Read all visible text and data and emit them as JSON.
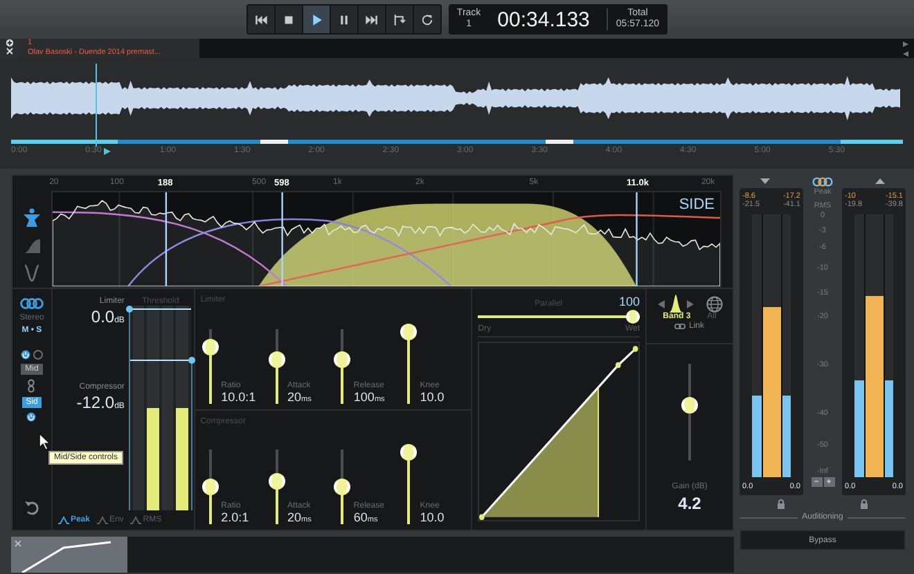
{
  "transport": {
    "buttons": [
      {
        "kind": "previous",
        "selected": false
      },
      {
        "kind": "stop",
        "selected": false
      },
      {
        "kind": "play",
        "selected": true
      },
      {
        "kind": "pause",
        "selected": false
      },
      {
        "kind": "next",
        "selected": false
      },
      {
        "kind": "loop",
        "selected": false
      },
      {
        "kind": "repeat",
        "selected": false
      }
    ],
    "track_label": "Track",
    "track_number": "1",
    "time": "00:34.133",
    "total_label": "Total",
    "total_time": "05:57.120"
  },
  "file_tab": {
    "number": "1",
    "title": "Olav Basoski - Duende 2014 premast..."
  },
  "timeline": {
    "playback": {
      "level": 0.094
    },
    "ticks": [
      "0:00",
      "0:30",
      "1:00",
      "1:30",
      "2:00",
      "2:30",
      "3:00",
      "3:30",
      "4:00",
      "4:30",
      "5:00",
      "5:30"
    ]
  },
  "spectrum": {
    "mode_label": "SIDE",
    "tools": [
      {
        "kind": "figure",
        "selected": true
      },
      {
        "kind": "shelf",
        "selected": false
      },
      {
        "kind": "notch",
        "selected": false
      }
    ],
    "scale": [
      {
        "label": "20",
        "marker": false
      },
      {
        "label": "100",
        "marker": false
      },
      {
        "label": "188",
        "marker": true
      },
      {
        "label": "500",
        "marker": false
      },
      {
        "label": "598",
        "marker": true
      },
      {
        "label": "1k",
        "marker": false
      },
      {
        "label": "2k",
        "marker": false
      },
      {
        "label": "5k",
        "marker": false
      },
      {
        "label": "11.0k",
        "marker": true
      },
      {
        "label": "20k",
        "marker": false
      }
    ]
  },
  "left_controls": {
    "stereo_label": "Stereo",
    "mode_label": "M • S",
    "buttons": [
      {
        "label": "Mid",
        "selected": false
      },
      {
        "label": "Sid",
        "selected": true
      }
    ],
    "tooltip": "Mid/Side controls"
  },
  "threshold": {
    "limiter_label": "Limiter",
    "limiter_value": "0.0",
    "limiter_unit": "dB",
    "title": "Threshold",
    "compressor_label": "Compressor",
    "compressor_value": "-12.0",
    "compressor_unit": "dB",
    "bars": [
      {
        "level": 0
      },
      {
        "level": 0.5
      },
      {
        "level": 0
      },
      {
        "level": 0.5
      }
    ],
    "handles": [
      {
        "kind": "limiter",
        "level": 1
      },
      {
        "kind": "compressor",
        "level": 0.74
      }
    ]
  },
  "detection": [
    {
      "label": "Peak",
      "selected": true
    },
    {
      "label": "Env",
      "selected": false
    },
    {
      "label": "RMS",
      "selected": false
    }
  ],
  "limiter": {
    "title": "Limiter",
    "sliders": [
      {
        "label": "Ratio",
        "value": "10.0:1",
        "level": 0.75
      },
      {
        "label": "Attack",
        "value": "20",
        "unit": "ms",
        "level": 0.55
      },
      {
        "label": "Release",
        "value": "100",
        "unit": "ms",
        "level": 0.55
      },
      {
        "label": "Knee",
        "value": "10.0",
        "level": 1
      }
    ]
  },
  "compressor": {
    "title": "Compressor",
    "sliders": [
      {
        "label": "Ratio",
        "value": "2.0:1",
        "level": 0.45
      },
      {
        "label": "Attack",
        "value": "20",
        "unit": "ms",
        "level": 0.55
      },
      {
        "label": "Release",
        "value": "60",
        "unit": "ms",
        "level": 0.45
      },
      {
        "label": "Knee",
        "value": "10.0",
        "level": 1
      }
    ]
  },
  "parallel": {
    "title": "Parallel",
    "value": "100",
    "level": 1,
    "dry_label": "Dry",
    "wet_label": "Wet"
  },
  "band": {
    "label": "Band 3",
    "all_label": "All",
    "link_label": "Link"
  },
  "gain": {
    "label": "Gain (dB)",
    "value": "4.2",
    "level": 0.55
  },
  "meters": {
    "scale_labels": [
      "Peak",
      "RMS"
    ],
    "zoom_buttons": [
      "−",
      "+"
    ],
    "scale": [
      "0",
      "-3",
      "-6",
      "-10",
      "-15",
      "-20",
      "-30",
      "-40",
      "-50",
      "-Inf"
    ],
    "groups": [
      {
        "kind": "down",
        "peak": [
          "-8.6",
          "-17.2"
        ],
        "rms": [
          "-21.5",
          "-41.1"
        ],
        "bars": [
          {
            "kind": "rms",
            "level": 0.31
          },
          {
            "kind": "peak",
            "level": 0.65
          },
          {
            "kind": "rms",
            "level": 0.31
          }
        ],
        "readouts": [
          "0.0",
          "0.0"
        ]
      },
      {
        "kind": "up",
        "peak": [
          "-10",
          "-15.1"
        ],
        "rms": [
          "-19.8",
          "-39.8"
        ],
        "bars": [
          {
            "kind": "rms",
            "level": 0.37
          },
          {
            "kind": "peak",
            "level": 0.69
          },
          {
            "kind": "rms",
            "level": 0.37
          }
        ],
        "readouts": [
          "0.0",
          "0.0"
        ]
      }
    ]
  },
  "auditioning_label": "Auditioning",
  "bypass_label": "Bypass"
}
